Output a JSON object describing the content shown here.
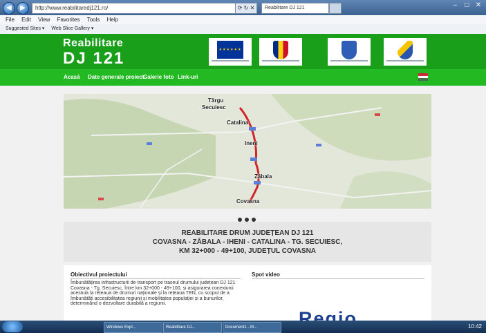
{
  "browser": {
    "address": "http://www.reabilitaredj121.ro/",
    "address_tools": "⟳ ↻ ✕",
    "tab_title": "Reabilitare DJ 121",
    "menu": [
      "File",
      "Edit",
      "View",
      "Favorites",
      "Tools",
      "Help"
    ],
    "favorites": [
      "Suggested Sites ▾",
      "Web Slice Gallery ▾"
    ]
  },
  "site": {
    "logo_line1": "Reabilitare",
    "logo_line2": "DJ 121",
    "nav": [
      "Acasă",
      "Date generale proiect",
      "Galerie foto",
      "Link-uri"
    ],
    "map_labels": {
      "tirgu": "Târgu",
      "secuiesc": "Secuiesc",
      "catalina": "Catalina",
      "ineni": "Ineni",
      "zabala": "Zăbala",
      "covasna": "Covasna"
    },
    "title_line1": "REABILITARE DRUM JUDEȚEAN DJ 121",
    "title_line2": "COVASNA - ZĂBALA - IHENI - CATALINA - TG. SECUIESC,",
    "title_line3": "KM 32+000 - 49+100, JUDEȚUL COVASNA",
    "objective_heading": "Obiectivul proiectului",
    "objective_text": "Îmbunătățirea infrastructurii de transport pe traseul drumului județean DJ 121 Covasna - Tg. Secuiesc, între km 32+000 - 49+100, și asigurarea conexiunii acestuia la rețeaua de drumuri naționale și la rețeaua TEN, cu scopul de a îmbunătăți accesibilitatea regiunii și mobilitatea populației și a bunurilor, determinând o dezvoltare durabilă a regiunii.",
    "video_heading": "Spot video",
    "regio_text": "Regio"
  },
  "taskbar": {
    "buttons": [
      "Windows Expl...",
      "Reabilitare DJ...",
      "Document1 - M..."
    ],
    "clock": "10:42"
  }
}
